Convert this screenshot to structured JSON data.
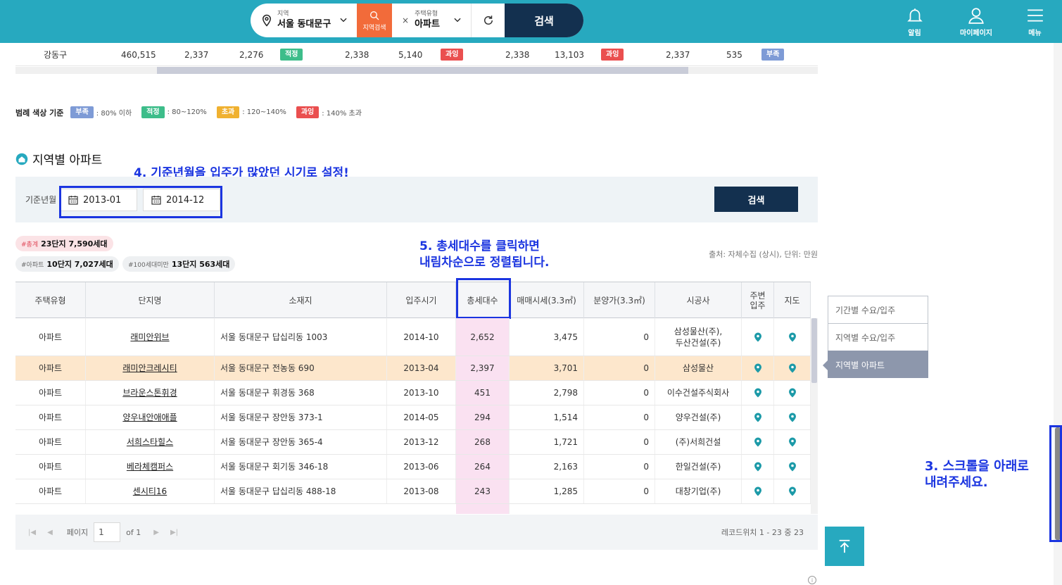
{
  "header": {
    "region_label": "지역",
    "region_value": "서울 동대문구",
    "region_search": "지역검색",
    "housing_label": "주택유형",
    "housing_value": "아파트",
    "housing_clear": "×",
    "search": "검색",
    "icons": [
      {
        "name": "bell-icon",
        "label": "알림"
      },
      {
        "name": "user-icon",
        "label": "마이페이지"
      },
      {
        "name": "menu-icon",
        "label": "메뉴"
      }
    ]
  },
  "prev_row": {
    "cells": [
      "강동구",
      "460,515",
      "2,337",
      "2,276",
      "2,338",
      "5,140",
      "2,338",
      "13,103",
      "2,337",
      "535"
    ],
    "badges": [
      "적정",
      "과잉",
      "과잉",
      "부족"
    ]
  },
  "legend": {
    "title": "범례 색상 기준",
    "items": [
      {
        "badge": "부족",
        "desc": ": 80% 이하",
        "color": "#7e9bd6"
      },
      {
        "badge": "적정",
        "desc": ": 80~120%",
        "color": "#3dbd8a"
      },
      {
        "badge": "초과",
        "desc": ": 120~140%",
        "color": "#f0b130"
      },
      {
        "badge": "과잉",
        "desc": ": 140% 초과",
        "color": "#ea4f4f"
      }
    ]
  },
  "section": {
    "title": "지역별 아파트"
  },
  "annotations": {
    "step4": "4. 기준년월을 입주가 많았던 시기로 설정!",
    "step5_line1": "5. 총세대수를 클릭하면",
    "step5_line2": "내림차순으로 정렬됩니다.",
    "step3_line1": "3. 스크롤을 아래로",
    "step3_line2": "내려주세요."
  },
  "filter": {
    "label": "기준년월",
    "from": "2013-01",
    "to": "2014-12",
    "search": "검색"
  },
  "summary": {
    "total_key": "#총계",
    "total_val": "23단지 7,590세대",
    "apt_key": "#아파트",
    "apt_val": "10단지 7,027세대",
    "small_key": "#100세대미만",
    "small_val": "13단지 563세대",
    "source": "출처: 자체수집 (상시), 단위: 만원"
  },
  "table": {
    "headers": [
      "주택유형",
      "단지명",
      "소재지",
      "입주시기",
      "총세대수",
      "매매시세(3.3㎡)",
      "분양가(3.3㎡)",
      "시공사",
      "주변\n입주",
      "지도"
    ],
    "rows": [
      {
        "type": "아파트",
        "name": "래미안위브",
        "addr": "서울 동대문구 답십리동 1003",
        "date": "2014-10",
        "units": "2,652",
        "price": "3,475",
        "presale": "0",
        "builder": "삼성물산(주),\n두산건설(주)"
      },
      {
        "type": "아파트",
        "name": "래미안크레시티",
        "addr": "서울 동대문구 전농동 690",
        "date": "2013-04",
        "units": "2,397",
        "price": "3,701",
        "presale": "0",
        "builder": "삼성물산"
      },
      {
        "type": "아파트",
        "name": "브라운스톤휘경",
        "addr": "서울 동대문구 휘경동 368",
        "date": "2013-10",
        "units": "451",
        "price": "2,798",
        "presale": "0",
        "builder": "이수건설주식회사"
      },
      {
        "type": "아파트",
        "name": "양우내안애애플",
        "addr": "서울 동대문구 장안동 373-1",
        "date": "2014-05",
        "units": "294",
        "price": "1,514",
        "presale": "0",
        "builder": "양우건설(주)"
      },
      {
        "type": "아파트",
        "name": "서희스타힐스",
        "addr": "서울 동대문구 장안동 365-4",
        "date": "2013-12",
        "units": "268",
        "price": "1,721",
        "presale": "0",
        "builder": "(주)서희건설"
      },
      {
        "type": "아파트",
        "name": "베라체캠퍼스",
        "addr": "서울 동대문구 회기동 346-18",
        "date": "2013-06",
        "units": "264",
        "price": "2,163",
        "presale": "0",
        "builder": "한일건설(주)"
      },
      {
        "type": "아파트",
        "name": "센시티16",
        "addr": "서울 동대문구 답십리동 488-18",
        "date": "2013-08",
        "units": "243",
        "price": "1,285",
        "presale": "0",
        "builder": "대창기업(주)"
      }
    ]
  },
  "pager": {
    "page_label": "페이지",
    "page_value": "1",
    "of": "of 1",
    "records": "레코드위치 1 - 23 중 23"
  },
  "sidenav": {
    "items": [
      "기간별 수요/입주",
      "지역별 수요/입주",
      "지역별 아파트"
    ]
  },
  "info": "i"
}
